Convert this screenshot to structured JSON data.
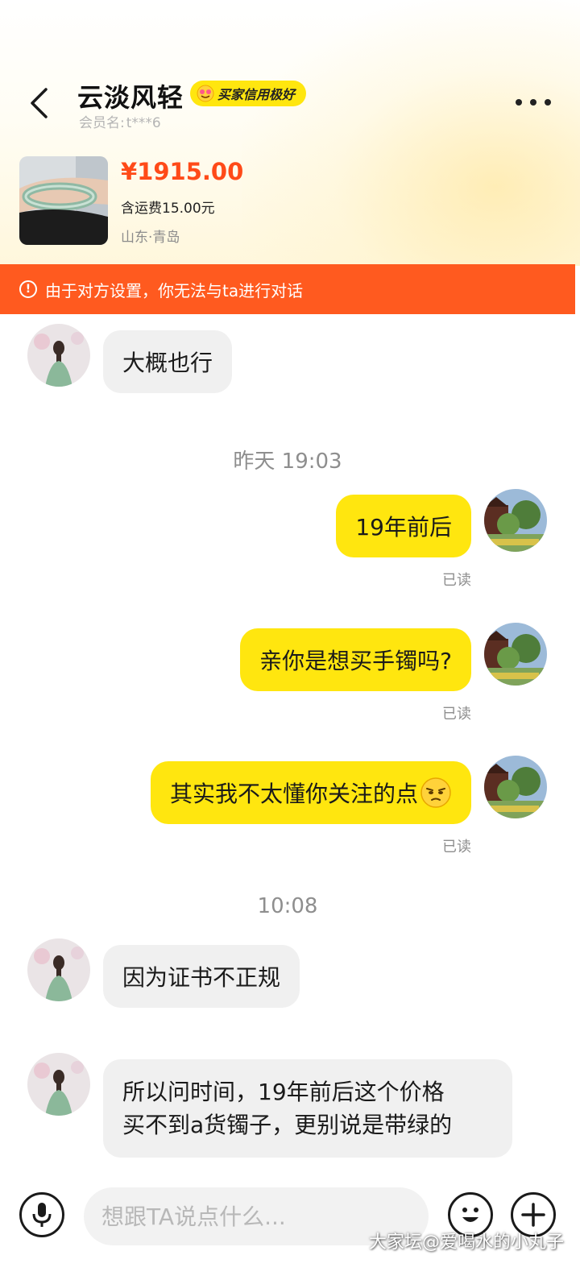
{
  "header": {
    "title": "云淡风轻",
    "credit_badge": "买家信用极好",
    "member_label": "会员名:",
    "member_name": "t***6"
  },
  "product": {
    "price": "¥1915.00",
    "shipping": "含运费15.00元",
    "location": "山东·青岛"
  },
  "banner": {
    "icon": "!",
    "text": "由于对方设置，你无法与ta进行对话"
  },
  "messages": {
    "m1": "大概也行",
    "ts1": "昨天 19:03",
    "m2": "19年前后",
    "m3": "亲你是想买手镯吗?",
    "m4": "其实我不太懂你关注的点",
    "read_label": "已读",
    "ts2": "10:08",
    "m5": "因为证书不正规",
    "m6_line1": "所以问时间，19年前后这个价格",
    "m6_line2": "买不到a货镯子，更别说是带绿的"
  },
  "input": {
    "placeholder": "想跟TA说点什么..."
  },
  "watermark": "大家坛@爱喝水的小丸子",
  "colors": {
    "brand_yellow": "#ffe60f",
    "banner_orange": "#ff5a1f",
    "price_red": "#ff4a18"
  },
  "icons": [
    "back-arrow-icon",
    "more-icon",
    "warning-icon",
    "mic-icon",
    "emoji-icon",
    "plus-icon",
    "pensive-emoji-icon"
  ]
}
